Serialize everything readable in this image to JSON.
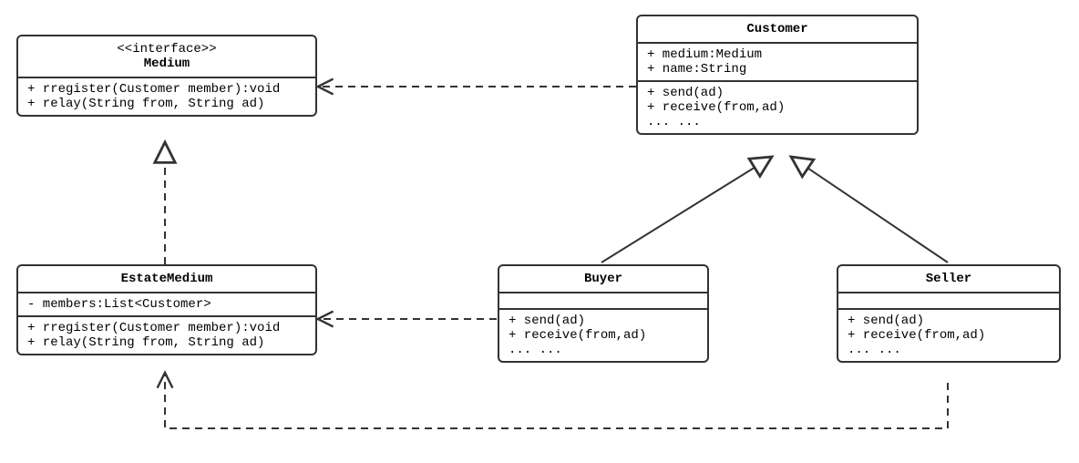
{
  "uml": {
    "medium": {
      "stereotype": "<<interface>>",
      "name": "Medium",
      "ops": [
        "+ rregister(Customer member):void",
        "+ relay(String from, String ad)"
      ]
    },
    "estateMedium": {
      "name": "EstateMedium",
      "attrs": [
        "- members:List<Customer>"
      ],
      "ops": [
        "+ rregister(Customer member):void",
        "+ relay(String from, String ad)"
      ]
    },
    "customer": {
      "name": "Customer",
      "attrs": [
        "+ medium:Medium",
        "+ name:String"
      ],
      "ops": [
        "+ send(ad)",
        "+ receive(from,ad)",
        "... ..."
      ]
    },
    "buyer": {
      "name": "Buyer",
      "ops": [
        "+ send(ad)",
        "+ receive(from,ad)",
        "... ..."
      ]
    },
    "seller": {
      "name": "Seller",
      "ops": [
        "+ send(ad)",
        "+ receive(from,ad)",
        "... ..."
      ]
    }
  },
  "chart_data": {
    "type": "uml-class-diagram",
    "classes": [
      {
        "id": "Medium",
        "stereotype": "interface",
        "operations": [
          "rregister(Customer member):void",
          "relay(String from, String ad)"
        ]
      },
      {
        "id": "EstateMedium",
        "attributes": [
          "members:List<Customer>"
        ],
        "operations": [
          "rregister(Customer member):void",
          "relay(String from, String ad)"
        ]
      },
      {
        "id": "Customer",
        "attributes": [
          "medium:Medium",
          "name:String"
        ],
        "operations": [
          "send(ad)",
          "receive(from,ad)"
        ]
      },
      {
        "id": "Buyer",
        "operations": [
          "send(ad)",
          "receive(from,ad)"
        ]
      },
      {
        "id": "Seller",
        "operations": [
          "send(ad)",
          "receive(from,ad)"
        ]
      }
    ],
    "relationships": [
      {
        "from": "EstateMedium",
        "to": "Medium",
        "kind": "realization"
      },
      {
        "from": "Customer",
        "to": "Medium",
        "kind": "dependency"
      },
      {
        "from": "Buyer",
        "to": "Customer",
        "kind": "generalization"
      },
      {
        "from": "Seller",
        "to": "Customer",
        "kind": "generalization"
      },
      {
        "from": "Buyer",
        "to": "EstateMedium",
        "kind": "dependency"
      },
      {
        "from": "Seller",
        "to": "EstateMedium",
        "kind": "dependency"
      }
    ]
  }
}
